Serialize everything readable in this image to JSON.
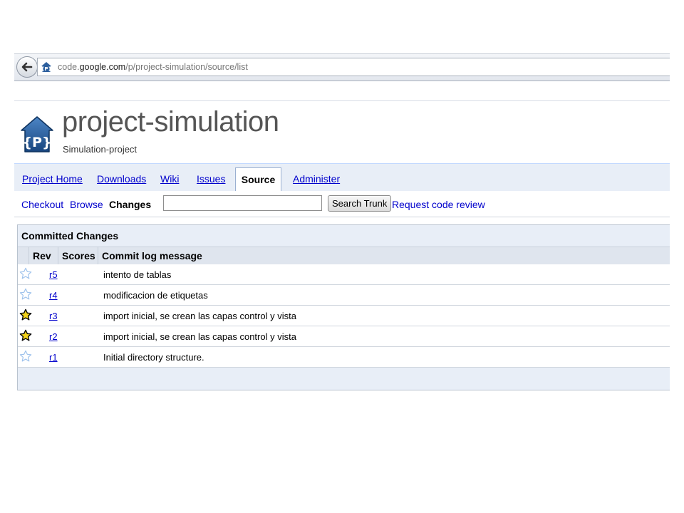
{
  "browser": {
    "url_scheme_host_prefix": "code.",
    "url_host": "google.com",
    "url_path": "/p/project-simulation/source/list"
  },
  "header": {
    "project_name": "project-simulation",
    "project_summary": "Simulation-project"
  },
  "main_tabs": {
    "project_home": "Project Home",
    "downloads": "Downloads",
    "wiki": "Wiki",
    "issues": "Issues",
    "source": "Source",
    "administer": "Administer"
  },
  "sub_nav": {
    "checkout": "Checkout",
    "browse": "Browse",
    "changes": "Changes",
    "search_value": "",
    "search_button": "Search Trunk",
    "request_review": "Request code review"
  },
  "changes": {
    "title": "Committed Changes",
    "columns": {
      "rev": "Rev",
      "scores": "Scores",
      "message": "Commit log message"
    },
    "rows": [
      {
        "rev": "r5",
        "message": "intento de tablas",
        "starred": false
      },
      {
        "rev": "r4",
        "message": "modificacion de etiquetas",
        "starred": false
      },
      {
        "rev": "r3",
        "message": "import inicial, se crean las capas control y vista",
        "starred": true
      },
      {
        "rev": "r2",
        "message": "import inicial, se crean las capas control y vista",
        "starred": true
      },
      {
        "rev": "r1",
        "message": "Initial directory structure.",
        "starred": false
      }
    ]
  },
  "colors": {
    "link": "#0000cc",
    "tab_bar": "#e8eef7",
    "star_filled": "#f2d21b",
    "star_empty_outline": "#9ec2ec"
  }
}
